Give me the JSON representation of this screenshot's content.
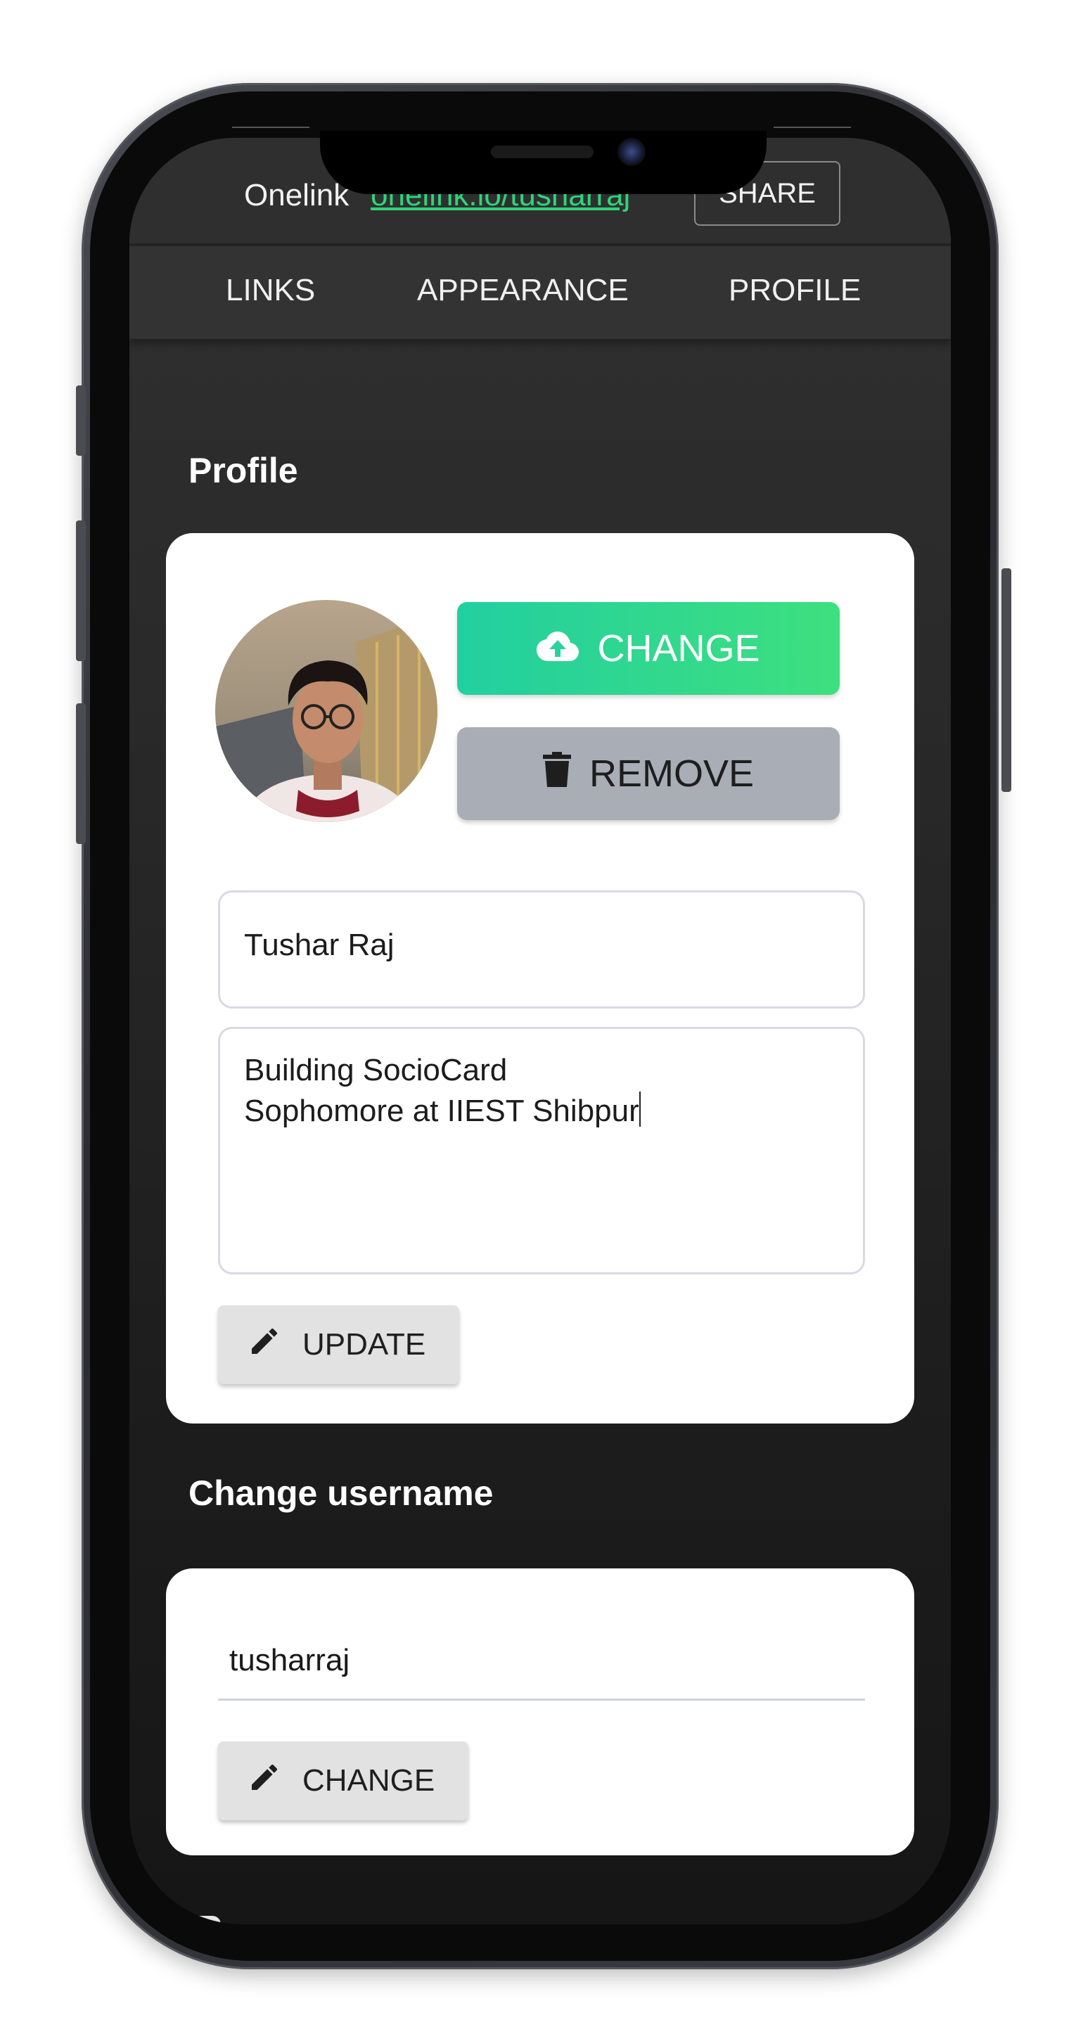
{
  "header": {
    "title": "Onelink",
    "link": "onelink.io/tusharraj",
    "share_label": "SHARE"
  },
  "tabs": [
    {
      "label": "LINKS"
    },
    {
      "label": "APPEARANCE"
    },
    {
      "label": "PROFILE"
    }
  ],
  "profile": {
    "section_title": "Profile",
    "change_photo_label": "CHANGE",
    "remove_photo_label": "REMOVE",
    "name_value": "Tushar Raj",
    "bio_lines": [
      "Building SocioCard",
      "Sophomore at IIEST Shibpur"
    ],
    "update_label": "UPDATE"
  },
  "username": {
    "section_title": "Change username",
    "value": "tusharraj",
    "change_label": "CHANGE"
  },
  "icons": {
    "upload": "cloud-upload-icon",
    "delete": "trash-icon",
    "edit": "pencil-icon"
  },
  "colors": {
    "accent_green": "#2ed47a",
    "gradient_start": "#22cfa0",
    "gradient_end": "#3ee07e",
    "remove_bg": "#a9adb6"
  }
}
